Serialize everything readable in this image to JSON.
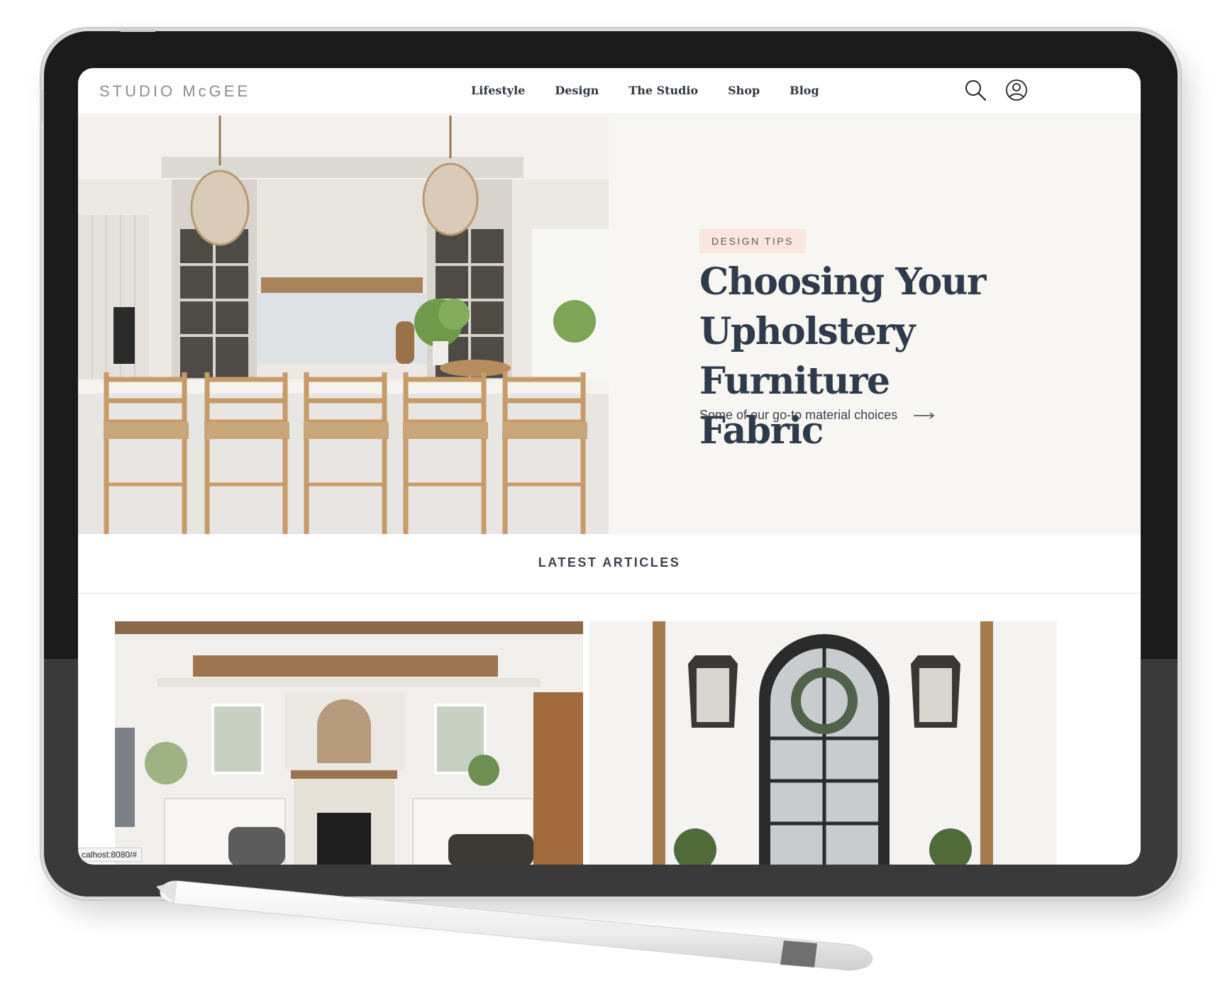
{
  "header": {
    "logo": "STUDIO McGEE",
    "nav": [
      "Lifestyle",
      "Design",
      "The Studio",
      "Shop",
      "Blog"
    ],
    "icons": [
      "search-icon",
      "user-account-icon"
    ]
  },
  "hero": {
    "tag": "DESIGN TIPS",
    "title": "Choosing Your Upholstery Furniture Fabric",
    "subtitle": "Some of our go-to material choices",
    "arrow_icon": "arrow-right-icon"
  },
  "latest": {
    "title": "LATEST ARTICLES"
  },
  "status_bar": {
    "url": "calhost:8080/#"
  },
  "colors": {
    "heading": "#2f3b4d",
    "tag_background": "#f9e6dc",
    "hero_panel": "#f7f6f2",
    "device_frame": "#1b1b1b"
  }
}
